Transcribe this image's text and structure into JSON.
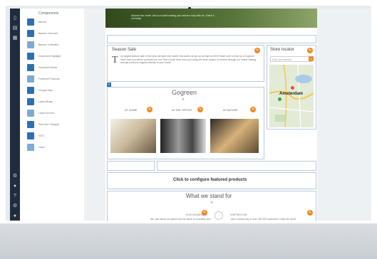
{
  "panel": {
    "title": "Components",
    "items": [
      {
        "label": "Banner",
        "icon": "banner-icon"
      },
      {
        "label": "Banner Carousel",
        "icon": "carousel-icon"
      },
      {
        "label": "Banner Collection",
        "icon": "collection-icon"
      },
      {
        "label": "Document Highlight",
        "icon": "document-icon"
      },
      {
        "label": "Document Block",
        "icon": "document-block-icon"
      },
      {
        "label": "Featured Products",
        "icon": "products-icon"
      },
      {
        "label": "Google Map",
        "icon": "map-icon"
      },
      {
        "label": "Latest Blogs",
        "icon": "blog-icon"
      },
      {
        "label": "Latest Events",
        "icon": "events-icon"
      },
      {
        "label": "Rich text / Snippet",
        "icon": "richtext-icon"
      },
      {
        "label": "SEO",
        "icon": "seo-icon"
      },
      {
        "label": "Video",
        "icon": "video-icon"
      }
    ]
  },
  "hero": {
    "text": "Autumn has come! Join us to start making your autumn cosy with us. Check it out today."
  },
  "season_sale": {
    "title": "Season Sale",
    "dropcap": "T",
    "text": "he largest season sale of the year will start next week! Discounts can go up as high as 50%! Make sure to drop by a Gogreen store near you before products run out. Find a local store near you using our store locator or browse through our online catalog and get products shipped directly to your home."
  },
  "store_locator": {
    "title": "Store locator",
    "search_placeholder": "Enter your address",
    "map_label": "Amsterdam"
  },
  "gogreen": {
    "title": "Gogreen",
    "categories": [
      "AT HOME",
      "IN THE OFFICE",
      "IN NATURE"
    ]
  },
  "featured": {
    "cta": "Click to configure featured products"
  },
  "stand_for": {
    "title": "What we stand for",
    "items": [
      {
        "label": "SUSTAINABILITY",
        "text": "We care about our planet and we strive to a durable and"
      },
      {
        "label": "INSPIRATION",
        "text": "Join a community of over 150,000 customers. Keep the world"
      }
    ]
  },
  "colors": {
    "accent_orange": "#f08a24",
    "brand_blue": "#2d6fb5",
    "rail": "#1f2d3d"
  }
}
